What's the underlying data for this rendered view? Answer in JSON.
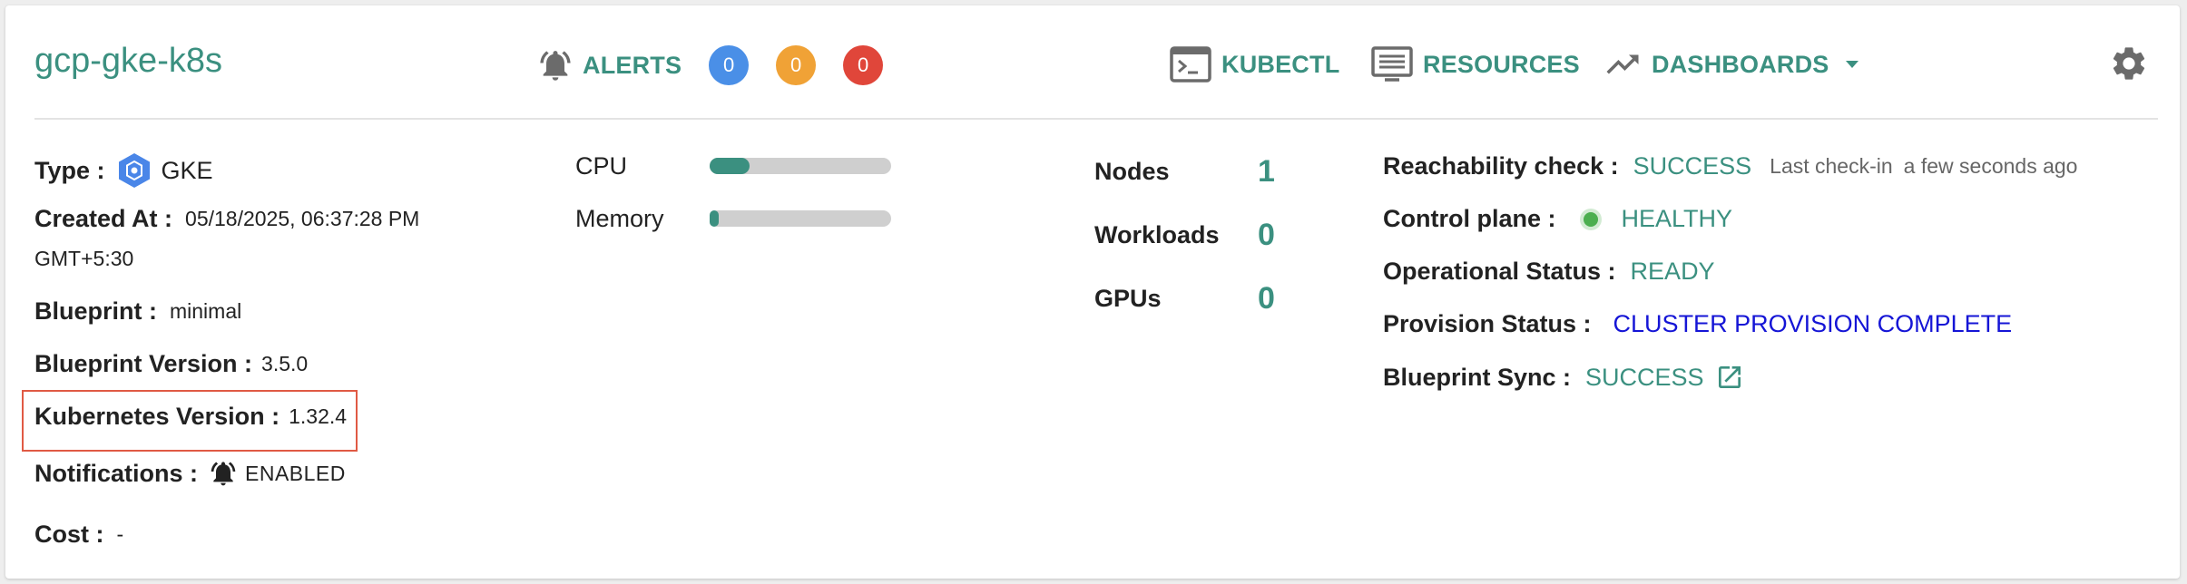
{
  "header": {
    "cluster_name": "gcp-gke-k8s",
    "alerts_label": "ALERTS",
    "alert_counts": [
      "0",
      "0",
      "0"
    ],
    "alert_colors": [
      "#4a8fe7",
      "#f0a236",
      "#e0463a"
    ],
    "kubectl_label": "KUBECTL",
    "resources_label": "RESOURCES",
    "dashboards_label": "DASHBOARDS"
  },
  "details": {
    "type_label": "Type :",
    "type_value": "GKE",
    "created_label": "Created At :",
    "created_value": "05/18/2025, 06:37:28 PM",
    "created_tz": "GMT+5:30",
    "blueprint_label": "Blueprint :",
    "blueprint_value": "minimal",
    "blueprint_version_label": "Blueprint Version :",
    "blueprint_version_value": "3.5.0",
    "k8s_version_label": "Kubernetes Version :",
    "k8s_version_value": "1.32.4",
    "notifications_label": "Notifications :",
    "notifications_value": "ENABLED",
    "cost_label": "Cost :",
    "cost_value": "-"
  },
  "metrics": {
    "cpu_label": "CPU",
    "cpu_fraction": 0.22,
    "memory_label": "Memory",
    "memory_fraction": 0.05
  },
  "counts": {
    "nodes_label": "Nodes",
    "nodes_value": "1",
    "workloads_label": "Workloads",
    "workloads_value": "0",
    "gpus_label": "GPUs",
    "gpus_value": "0"
  },
  "status": {
    "reachability_label": "Reachability check :",
    "reachability_value": "SUCCESS",
    "last_checkin_label": "Last check-in",
    "last_checkin_value": "a few seconds ago",
    "control_plane_label": "Control plane :",
    "control_plane_value": "HEALTHY",
    "operational_label": "Operational Status :",
    "operational_value": "READY",
    "provision_label": "Provision Status :",
    "provision_value": "CLUSTER PROVISION COMPLETE",
    "blueprint_sync_label": "Blueprint Sync :",
    "blueprint_sync_value": "SUCCESS"
  },
  "icons": {
    "alerts": "bell-icon",
    "kubectl": "terminal-icon",
    "resources": "list-icon",
    "dashboards": "trending-up-icon",
    "settings": "gear-icon",
    "type": "gke-hexagon-icon",
    "notifications": "bell-icon",
    "external": "external-link-icon"
  }
}
